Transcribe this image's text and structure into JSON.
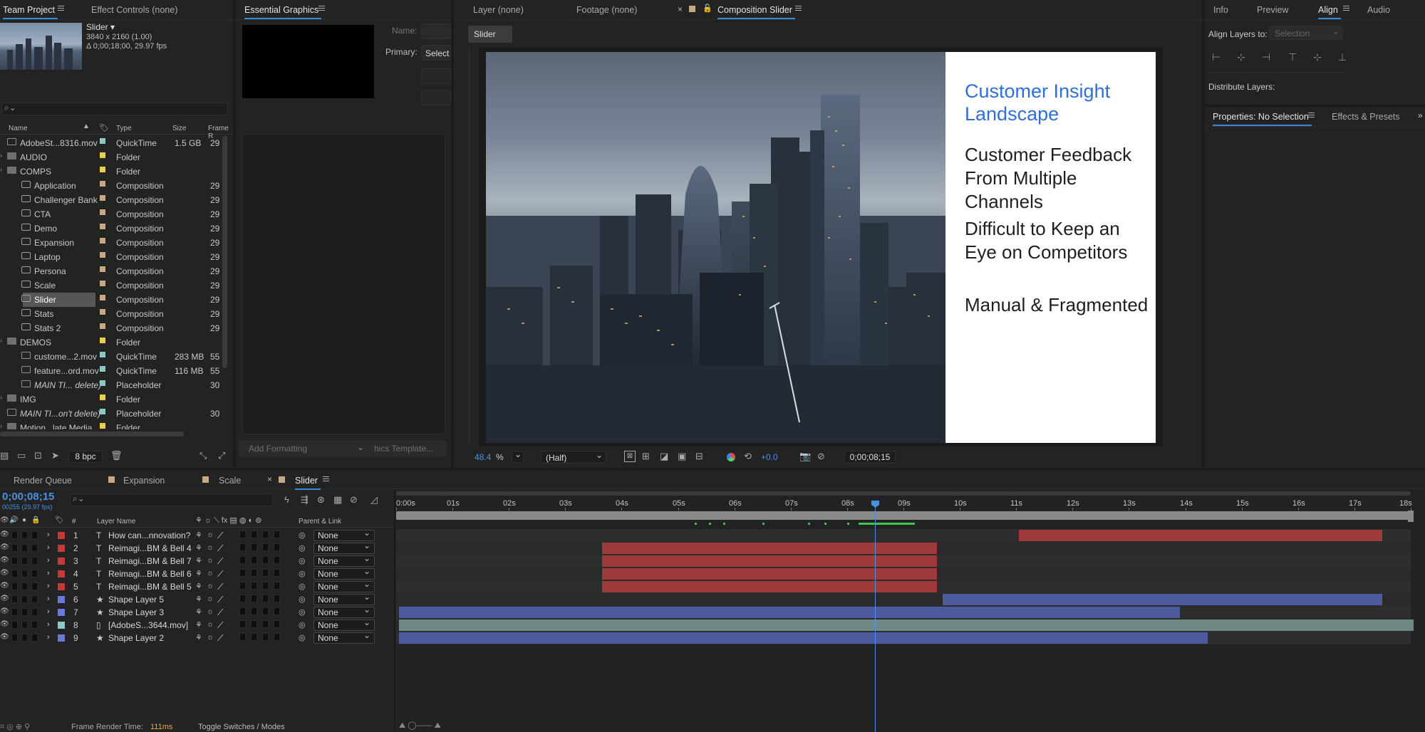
{
  "project": {
    "tab_label": "Team Project",
    "effect_controls_label": "Effect Controls (none)",
    "preview_name": "Slider ▾",
    "preview_res": "3840 x 2160 (1.00)",
    "preview_duration": "Δ 0;00;18;00, 29.97 fps",
    "columns": {
      "name": "Name",
      "type": "Type",
      "size": "Size",
      "frame": "Frame R"
    },
    "items": [
      {
        "name": "AdobeSt...8316.mov",
        "type": "QuickTime",
        "size": "1.5 GB",
        "frame": "29",
        "icon": "movie-file-icon",
        "color": "#8ec7c7",
        "indent": 0,
        "italic": false
      },
      {
        "name": "AUDIO",
        "type": "Folder",
        "size": "",
        "frame": "",
        "icon": "folder-icon",
        "color": "#e6d24a",
        "indent": 0,
        "italic": false
      },
      {
        "name": "COMPS",
        "type": "Folder",
        "size": "",
        "frame": "",
        "icon": "folder-icon",
        "color": "#e6d24a",
        "indent": 0,
        "italic": false
      },
      {
        "name": "Application",
        "type": "Composition",
        "size": "",
        "frame": "29",
        "icon": "composition-icon",
        "color": "#c8a882",
        "indent": 1,
        "italic": false
      },
      {
        "name": "Challenger Bank",
        "type": "Composition",
        "size": "",
        "frame": "29",
        "icon": "composition-icon",
        "color": "#c8a882",
        "indent": 1,
        "italic": false
      },
      {
        "name": "CTA",
        "type": "Composition",
        "size": "",
        "frame": "29",
        "icon": "composition-icon",
        "color": "#c8a882",
        "indent": 1,
        "italic": false
      },
      {
        "name": "Demo",
        "type": "Composition",
        "size": "",
        "frame": "29",
        "icon": "composition-icon",
        "color": "#c8a882",
        "indent": 1,
        "italic": false
      },
      {
        "name": "Expansion",
        "type": "Composition",
        "size": "",
        "frame": "29",
        "icon": "composition-icon",
        "color": "#c8a882",
        "indent": 1,
        "italic": false
      },
      {
        "name": "Laptop",
        "type": "Composition",
        "size": "",
        "frame": "29",
        "icon": "composition-icon",
        "color": "#c8a882",
        "indent": 1,
        "italic": false
      },
      {
        "name": "Persona",
        "type": "Composition",
        "size": "",
        "frame": "29",
        "icon": "composition-icon",
        "color": "#c8a882",
        "indent": 1,
        "italic": false
      },
      {
        "name": "Scale",
        "type": "Composition",
        "size": "",
        "frame": "29",
        "icon": "composition-icon",
        "color": "#c8a882",
        "indent": 1,
        "italic": false
      },
      {
        "name": "Slider",
        "type": "Composition",
        "size": "",
        "frame": "29",
        "icon": "composition-icon",
        "color": "#c8a882",
        "indent": 1,
        "italic": false,
        "selected": true
      },
      {
        "name": "Stats",
        "type": "Composition",
        "size": "",
        "frame": "29",
        "icon": "composition-icon",
        "color": "#c8a882",
        "indent": 1,
        "italic": false
      },
      {
        "name": "Stats 2",
        "type": "Composition",
        "size": "",
        "frame": "29",
        "icon": "composition-icon",
        "color": "#c8a882",
        "indent": 1,
        "italic": false
      },
      {
        "name": "DEMOS",
        "type": "Folder",
        "size": "",
        "frame": "",
        "icon": "folder-icon",
        "color": "#e6d24a",
        "indent": 0,
        "italic": false
      },
      {
        "name": "custome...2.mov",
        "type": "QuickTime",
        "size": "283 MB",
        "frame": "55",
        "icon": "movie-file-icon",
        "color": "#8ec7c7",
        "indent": 1,
        "italic": false
      },
      {
        "name": "feature...ord.mov",
        "type": "QuickTime",
        "size": "116 MB",
        "frame": "55",
        "icon": "movie-file-icon",
        "color": "#8ec7c7",
        "indent": 1,
        "italic": false
      },
      {
        "name": "MAIN TI... delete)",
        "type": "Placeholder",
        "size": "",
        "frame": "30",
        "icon": "placeholder-icon",
        "color": "#8ec7c7",
        "indent": 1,
        "italic": true
      },
      {
        "name": "IMG",
        "type": "Folder",
        "size": "",
        "frame": "",
        "icon": "folder-icon",
        "color": "#e6d24a",
        "indent": 0,
        "italic": false
      },
      {
        "name": "MAIN TI...on't delete)",
        "type": "Placeholder",
        "size": "",
        "frame": "30",
        "icon": "placeholder-icon",
        "color": "#8ec7c7",
        "indent": 0,
        "italic": true
      },
      {
        "name": "Motion...late Media",
        "type": "Folder",
        "size": "",
        "frame": "",
        "icon": "folder-icon",
        "color": "#e6d24a",
        "indent": 0,
        "italic": false
      }
    ],
    "bpc_label": "8 bpc"
  },
  "essential": {
    "tab_label": "Essential Graphics",
    "name_label": "Name:",
    "primary_label": "Primary:",
    "primary_value": "Select",
    "add_formatting": "Add Formatting",
    "templates": "hics Template..."
  },
  "viewer": {
    "tabs": [
      "Layer (none)",
      "Footage (none)",
      "Composition Slider"
    ],
    "comp_chip": "Slider",
    "slide": {
      "title": "Customer Insight Landscape",
      "points": [
        "Customer Feedback From Multiple Channels",
        "Difficult to Keep an Eye on Competitors",
        "Manual & Fragmented"
      ]
    },
    "zoom": "48.4",
    "zoom_unit": "%",
    "resolution": "(Half)",
    "exposure": "+0.0",
    "timecode": "0;00;08;15"
  },
  "right": {
    "tabs": [
      "Info",
      "Preview",
      "Align",
      "Audio"
    ],
    "align_layers_label": "Align Layers to:",
    "align_to_value": "Selection",
    "distribute_label": "Distribute Layers:",
    "props_tab": "Properties: No Selection",
    "effects_tab": "Effects & Presets"
  },
  "timeline": {
    "tabs": [
      "Render Queue",
      "Expansion",
      "Scale",
      "Slider"
    ],
    "timecode": "0;00;08;15",
    "fps_label": "00255 (29.97 fps)",
    "headers": {
      "layer_name": "Layer Name",
      "parent": "Parent & Link",
      "num": "#"
    },
    "ruler": [
      "0:00s",
      "01s",
      "02s",
      "03s",
      "04s",
      "05s",
      "06s",
      "07s",
      "08s",
      "09s",
      "10s",
      "11s",
      "12s",
      "13s",
      "14s",
      "15s",
      "16s",
      "17s",
      "18s"
    ],
    "duration_seconds": 18,
    "playhead_seconds": 8.5,
    "layers": [
      {
        "num": "1",
        "name": "How can...nnovation?",
        "type": "T",
        "color": "#c23b3b",
        "bar_color": "#9e3a3a",
        "start": 11,
        "end": 17.5,
        "parent": "None"
      },
      {
        "num": "2",
        "name": "Reimagi...BM & Bell 4",
        "type": "T",
        "color": "#c23b3b",
        "bar_color": "#9e3a3a",
        "start": 3.6,
        "end": 9.6,
        "parent": "None"
      },
      {
        "num": "3",
        "name": "Reimagi...BM & Bell 7",
        "type": "T",
        "color": "#c23b3b",
        "bar_color": "#9e3a3a",
        "start": 3.6,
        "end": 9.6,
        "parent": "None"
      },
      {
        "num": "4",
        "name": "Reimagi...BM & Bell 6",
        "type": "T",
        "color": "#c23b3b",
        "bar_color": "#9e3a3a",
        "start": 3.6,
        "end": 9.6,
        "parent": "None"
      },
      {
        "num": "5",
        "name": "Reimagi...BM & Bell 5",
        "type": "T",
        "color": "#c23b3b",
        "bar_color": "#9e3a3a",
        "start": 3.6,
        "end": 9.6,
        "parent": "None"
      },
      {
        "num": "6",
        "name": "Shape Layer 5",
        "type": "★",
        "color": "#6a79d8",
        "bar_color": "#4e5a9e",
        "start": 9.65,
        "end": 17.5,
        "parent": "None"
      },
      {
        "num": "7",
        "name": "Shape Layer 3",
        "type": "★",
        "color": "#6a79d8",
        "bar_color": "#4e5a9e",
        "start": 0,
        "end": 13.9,
        "parent": "None"
      },
      {
        "num": "8",
        "name": "[AdobeS...3644.mov]",
        "type": "▯",
        "color": "#8ec7c7",
        "bar_color": "#6f8a86",
        "start": 0,
        "end": 18,
        "parent": "None"
      },
      {
        "num": "9",
        "name": "Shape Layer 2",
        "type": "★",
        "color": "#6a79d8",
        "bar_color": "#4e5a9e",
        "start": 0,
        "end": 14.4,
        "parent": "None"
      }
    ],
    "frame_render_label": "Frame Render Time:",
    "frame_render_value": "111ms",
    "toggle_label": "Toggle Switches / Modes"
  }
}
